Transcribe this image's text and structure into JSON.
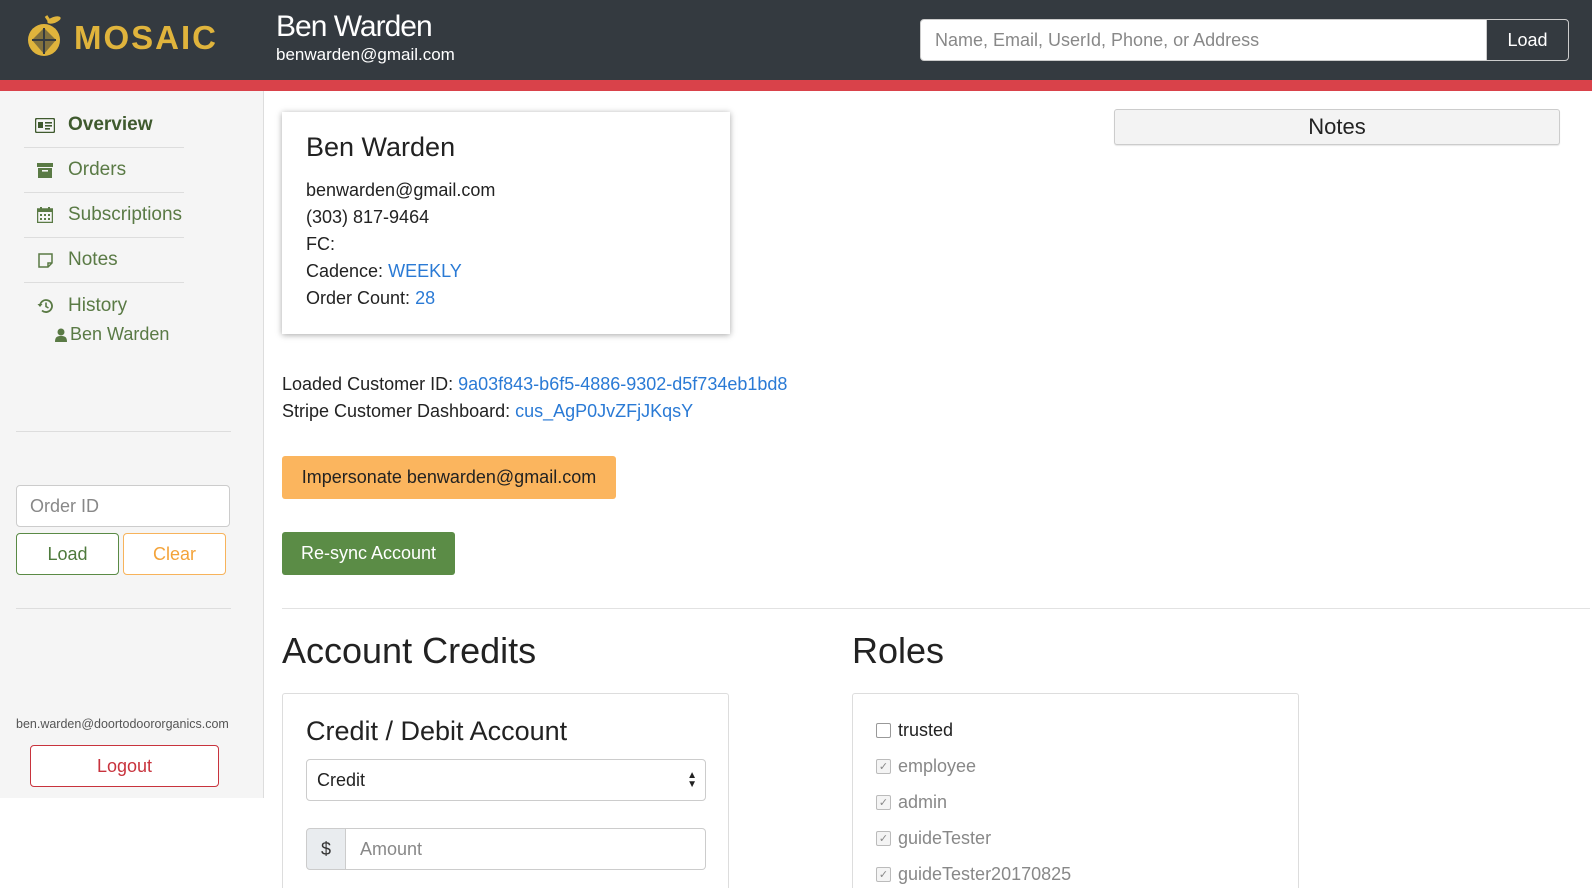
{
  "header": {
    "logo_text": "MOSAIC",
    "user_name": "Ben Warden",
    "user_email": "benwarden@gmail.com",
    "search_placeholder": "Name, Email, UserId, Phone, or Address",
    "load_label": "Load"
  },
  "sidebar": {
    "items": [
      {
        "label": "Overview",
        "icon": "id-card-icon"
      },
      {
        "label": "Orders",
        "icon": "archive-icon"
      },
      {
        "label": "Subscriptions",
        "icon": "calendar-icon"
      },
      {
        "label": "Notes",
        "icon": "note-icon"
      },
      {
        "label": "History",
        "icon": "history-icon"
      }
    ],
    "sub_item": "Ben Warden",
    "order_placeholder": "Order ID",
    "load_label": "Load",
    "clear_label": "Clear",
    "account_email": "ben.warden@doortodoororganics.com",
    "logout_label": "Logout"
  },
  "customer": {
    "name": "Ben Warden",
    "email": "benwarden@gmail.com",
    "phone": "(303) 817-9464",
    "fc_label": "FC:",
    "cadence_label": "Cadence:",
    "cadence_value": "WEEKLY",
    "order_count_label": "Order Count:",
    "order_count_value": "28"
  },
  "notes_title": "Notes",
  "loaded": {
    "id_label": "Loaded Customer ID:",
    "id_value": "9a03f843-b6f5-4886-9302-d5f734eb1bd8",
    "stripe_label": "Stripe Customer Dashboard:",
    "stripe_value": "cus_AgP0JvZFjJKqsY"
  },
  "actions": {
    "impersonate_label": "Impersonate benwarden@gmail.com",
    "resync_label": "Re-sync Account"
  },
  "credits": {
    "heading": "Account Credits",
    "panel_title": "Credit / Debit Account",
    "select_value": "Credit",
    "currency": "$",
    "amount_placeholder": "Amount"
  },
  "roles": {
    "heading": "Roles",
    "items": [
      {
        "label": "trusted",
        "checked": false,
        "disabled": false
      },
      {
        "label": "employee",
        "checked": true,
        "disabled": true
      },
      {
        "label": "admin",
        "checked": true,
        "disabled": true
      },
      {
        "label": "guideTester",
        "checked": true,
        "disabled": true
      },
      {
        "label": "guideTester20170825",
        "checked": true,
        "disabled": true
      }
    ]
  },
  "colors": {
    "header_bg": "#343a40",
    "accent_red": "#d9424a",
    "brand_green": "#5b8c46",
    "warning_orange": "#fbb55e",
    "link_blue": "#2a7ad5"
  }
}
